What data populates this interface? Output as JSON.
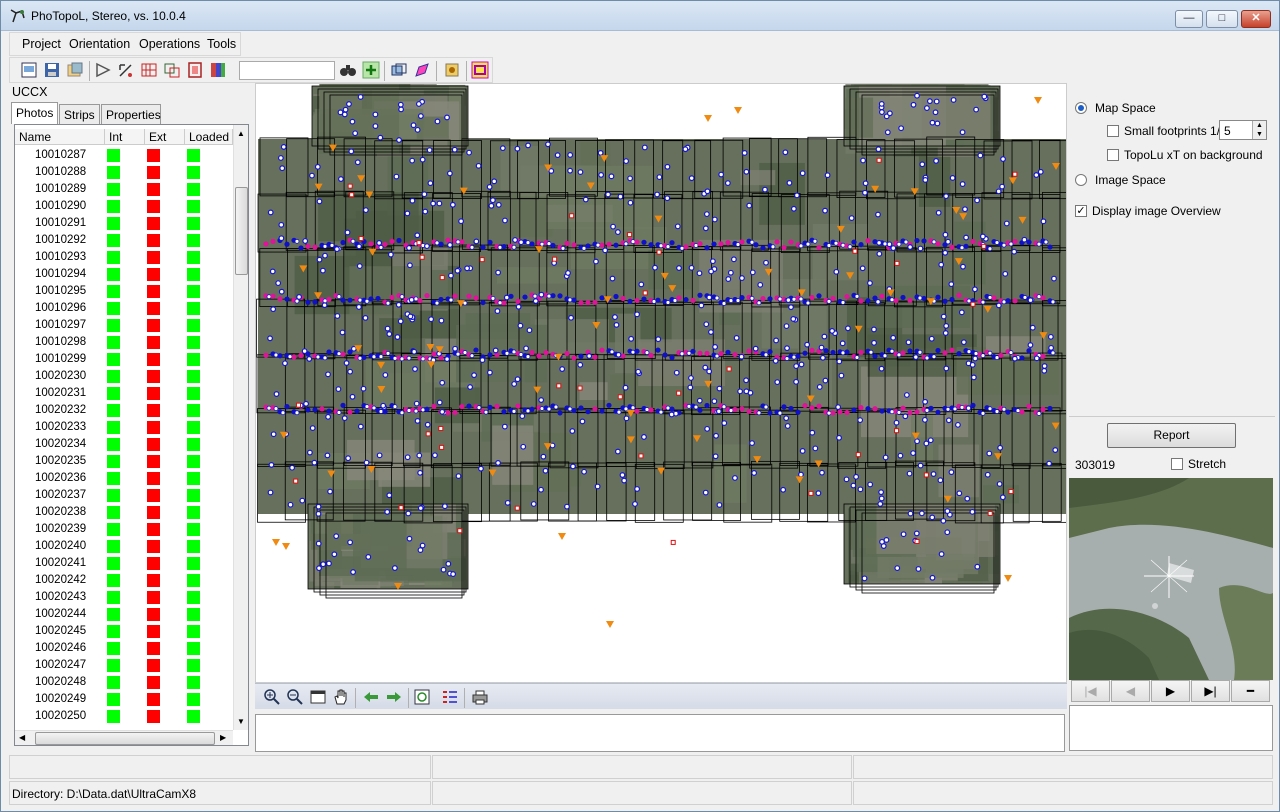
{
  "window": {
    "title": "PhoTopoL, Stereo, vs. 10.0.4",
    "min": "—",
    "max": "□",
    "close": "✕"
  },
  "menu": [
    "Project",
    "Orientation",
    "Operations",
    "Tools"
  ],
  "project_name": "UCCX",
  "tabs": [
    "Photos",
    "Strips",
    "Properties"
  ],
  "table": {
    "columns": [
      "Name",
      "Int",
      "Ext",
      "Loaded"
    ],
    "rows": [
      "10010287",
      "10010288",
      "10010289",
      "10010290",
      "10010291",
      "10010292",
      "10010293",
      "10010294",
      "10010295",
      "10010296",
      "10010297",
      "10010298",
      "10010299",
      "10020230",
      "10020231",
      "10020232",
      "10020233",
      "10020234",
      "10020235",
      "10020236",
      "10020237",
      "10020238",
      "10020239",
      "10020240",
      "10020241",
      "10020242",
      "10020243",
      "10020244",
      "10020245",
      "10020246",
      "10020247",
      "10020248",
      "10020249",
      "10020250"
    ],
    "status_colors": {
      "int": "#00ff00",
      "ext": "#ff0000",
      "loaded": "#00ff00"
    }
  },
  "right": {
    "map_space": "Map Space",
    "small_footprints": "Small footprints  1/",
    "small_footprints_value": "5",
    "topolu": "TopoLu xT on background",
    "image_space": "Image Space",
    "display_overview": "Display image Overview",
    "report": "Report",
    "photo_id": "303019",
    "stretch": "Stretch",
    "nav": [
      "|◀",
      "◀",
      "▶",
      "▶|",
      "━"
    ]
  },
  "status": {
    "directory": "Directory: D:\\Data.dat\\UltraCamX8"
  },
  "icons": [
    "new-icon",
    "save-icon",
    "open-icon",
    "orient-icon",
    "point-icon",
    "strip-icon",
    "tie-icon",
    "block-icon",
    "bundle-icon",
    "find-icon",
    "add-icon",
    "layers-icon",
    "edit-icon",
    "compute-icon",
    "export-icon",
    "zoom-in-icon",
    "zoom-out-icon",
    "fit-icon",
    "pan-icon",
    "back-icon",
    "forward-icon",
    "refresh-icon",
    "legend-icon",
    "print-icon"
  ]
}
